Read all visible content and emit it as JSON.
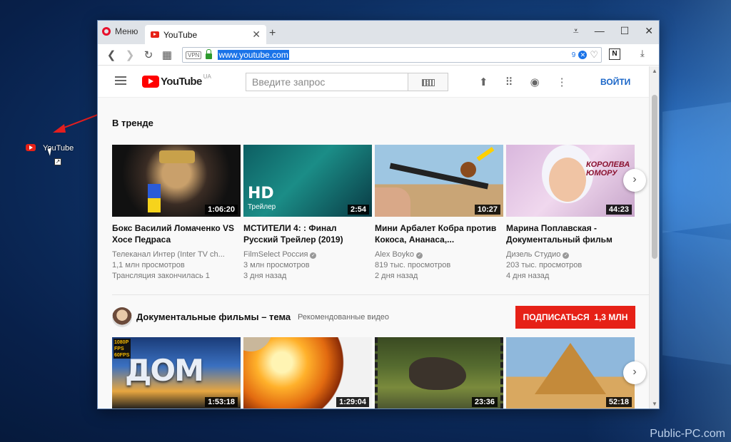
{
  "desktop": {
    "icon_label": "YouTube",
    "watermark": "Public-PC.com"
  },
  "browser": {
    "menu_label": "Меню",
    "tab_title": "YouTube",
    "tab_close": "✕",
    "new_tab": "+",
    "window_controls": [
      "⩡",
      "—",
      "☐",
      "✕"
    ],
    "vpn_label": "VPN",
    "url": "www.youtube.com",
    "blocked_count": "9"
  },
  "youtube": {
    "logo_text": "YouTube",
    "logo_region": "UA",
    "search_placeholder": "Введите запрос",
    "signin": "ВОЙТИ",
    "trending_title": "В тренде",
    "trending": [
      {
        "title": "Бокс Василий Ломаченко VS Хосе Педраса",
        "channel": "Телеканал Интер (Inter TV ch...",
        "views": "1,1 млн просмотров",
        "age": "Трансляция закончилась 1",
        "duration": "1:06:20",
        "verified": false
      },
      {
        "title": "МСТИТЕЛИ 4: : Финал Русский Трейлер (2019)",
        "channel": "FilmSelect Россия",
        "views": "3 млн просмотров",
        "age": "3 дня назад",
        "duration": "2:54",
        "verified": true,
        "thumb_text": "HD",
        "thumb_sub": "Трейлер"
      },
      {
        "title": "Мини Арбалет Кобра против Кокоса, Ананаса,...",
        "channel": "Alex Boyko",
        "views": "819 тыс. просмотров",
        "age": "2 дня назад",
        "duration": "10:27",
        "verified": true
      },
      {
        "title": "Марина Поплавская - Документальный фильм",
        "channel": "Дизель Студио",
        "views": "203 тыс. просмотров",
        "age": "4 дня назад",
        "duration": "44:23",
        "verified": true,
        "thumb_text": "КОРОЛЕВА ЮМОРУ"
      }
    ],
    "channel_section": {
      "title": "Документальные фильмы – тема",
      "subtitle": "Рекомендованные видео",
      "subscribe_label": "ПОДПИСАТЬСЯ",
      "subscribers": "1,3 МЛН"
    },
    "docs": [
      {
        "duration": "1:53:18",
        "thumb_text": "ДОМ",
        "badge": "1080P FPS 60FPS"
      },
      {
        "duration": "1:29:04"
      },
      {
        "duration": "23:36"
      },
      {
        "duration": "52:18"
      }
    ],
    "accent_red": "#e62117",
    "link_blue": "#1a66c8"
  }
}
